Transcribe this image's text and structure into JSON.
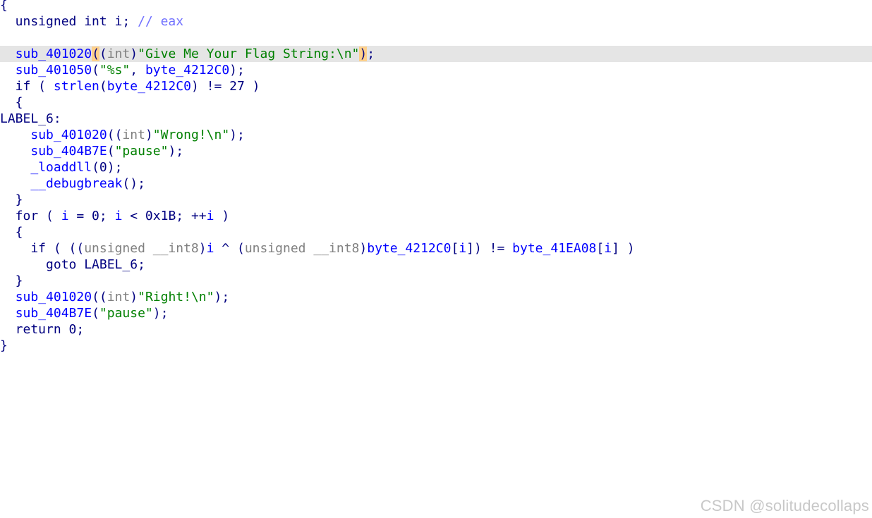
{
  "editor": {
    "current_line": 3,
    "lines": [
      {
        "tokens": [
          {
            "t": "{",
            "c": "plain"
          }
        ]
      },
      {
        "tokens": [
          {
            "t": "  unsigned int i; ",
            "c": "plain"
          },
          {
            "t": "// eax",
            "c": "cmt"
          }
        ]
      },
      {
        "tokens": []
      },
      {
        "tokens": [
          {
            "t": "  ",
            "c": "plain"
          },
          {
            "t": "sub_401020",
            "c": "func"
          },
          {
            "t": "(",
            "c": "paren-hl"
          },
          {
            "t": "(",
            "c": "plain"
          },
          {
            "t": "int",
            "c": "type"
          },
          {
            "t": ")",
            "c": "plain"
          },
          {
            "t": "\"Give Me Your Flag String:\\n\"",
            "c": "str"
          },
          {
            "t": ")",
            "c": "paren-hl"
          },
          {
            "t": ";",
            "c": "plain"
          }
        ]
      },
      {
        "tokens": [
          {
            "t": "  ",
            "c": "plain"
          },
          {
            "t": "sub_401050",
            "c": "func"
          },
          {
            "t": "(",
            "c": "plain"
          },
          {
            "t": "\"%s\"",
            "c": "str"
          },
          {
            "t": ", ",
            "c": "plain"
          },
          {
            "t": "byte_4212C0",
            "c": "func"
          },
          {
            "t": ");",
            "c": "plain"
          }
        ]
      },
      {
        "tokens": [
          {
            "t": "  if ( ",
            "c": "plain"
          },
          {
            "t": "strlen",
            "c": "func"
          },
          {
            "t": "(",
            "c": "plain"
          },
          {
            "t": "byte_4212C0",
            "c": "func"
          },
          {
            "t": ") != 27 )",
            "c": "plain"
          }
        ]
      },
      {
        "tokens": [
          {
            "t": "  {",
            "c": "plain"
          }
        ]
      },
      {
        "tokens": [
          {
            "t": "LABEL_6:",
            "c": "label"
          }
        ]
      },
      {
        "tokens": [
          {
            "t": "    ",
            "c": "plain"
          },
          {
            "t": "sub_401020",
            "c": "func"
          },
          {
            "t": "((",
            "c": "plain"
          },
          {
            "t": "int",
            "c": "type"
          },
          {
            "t": ")",
            "c": "plain"
          },
          {
            "t": "\"Wrong!\\n\"",
            "c": "str"
          },
          {
            "t": ");",
            "c": "plain"
          }
        ]
      },
      {
        "tokens": [
          {
            "t": "    ",
            "c": "plain"
          },
          {
            "t": "sub_404B7E",
            "c": "func"
          },
          {
            "t": "(",
            "c": "plain"
          },
          {
            "t": "\"pause\"",
            "c": "str"
          },
          {
            "t": ");",
            "c": "plain"
          }
        ]
      },
      {
        "tokens": [
          {
            "t": "    ",
            "c": "plain"
          },
          {
            "t": "_loaddll",
            "c": "func"
          },
          {
            "t": "(0);",
            "c": "plain"
          }
        ]
      },
      {
        "tokens": [
          {
            "t": "    ",
            "c": "plain"
          },
          {
            "t": "__debugbreak",
            "c": "func"
          },
          {
            "t": "();",
            "c": "plain"
          }
        ]
      },
      {
        "tokens": [
          {
            "t": "  }",
            "c": "plain"
          }
        ]
      },
      {
        "tokens": [
          {
            "t": "  for ( ",
            "c": "plain"
          },
          {
            "t": "i",
            "c": "var"
          },
          {
            "t": " = 0; ",
            "c": "plain"
          },
          {
            "t": "i",
            "c": "var"
          },
          {
            "t": " < 0x1B; ++",
            "c": "plain"
          },
          {
            "t": "i",
            "c": "var"
          },
          {
            "t": " )",
            "c": "plain"
          }
        ]
      },
      {
        "tokens": [
          {
            "t": "  {",
            "c": "plain"
          }
        ]
      },
      {
        "tokens": [
          {
            "t": "    if ( ((",
            "c": "plain"
          },
          {
            "t": "unsigned __int8",
            "c": "type"
          },
          {
            "t": ")",
            "c": "plain"
          },
          {
            "t": "i",
            "c": "var"
          },
          {
            "t": " ^ (",
            "c": "plain"
          },
          {
            "t": "unsigned __int8",
            "c": "type"
          },
          {
            "t": ")",
            "c": "plain"
          },
          {
            "t": "byte_4212C0",
            "c": "func"
          },
          {
            "t": "[",
            "c": "plain"
          },
          {
            "t": "i",
            "c": "var"
          },
          {
            "t": "]) != ",
            "c": "plain"
          },
          {
            "t": "byte_41EA08",
            "c": "func"
          },
          {
            "t": "[",
            "c": "plain"
          },
          {
            "t": "i",
            "c": "var"
          },
          {
            "t": "] )",
            "c": "plain"
          }
        ]
      },
      {
        "tokens": [
          {
            "t": "      goto LABEL_6;",
            "c": "plain"
          }
        ]
      },
      {
        "tokens": [
          {
            "t": "  }",
            "c": "plain"
          }
        ]
      },
      {
        "tokens": [
          {
            "t": "  ",
            "c": "plain"
          },
          {
            "t": "sub_401020",
            "c": "func"
          },
          {
            "t": "((",
            "c": "plain"
          },
          {
            "t": "int",
            "c": "type"
          },
          {
            "t": ")",
            "c": "plain"
          },
          {
            "t": "\"Right!\\n\"",
            "c": "str"
          },
          {
            "t": ");",
            "c": "plain"
          }
        ]
      },
      {
        "tokens": [
          {
            "t": "  ",
            "c": "plain"
          },
          {
            "t": "sub_404B7E",
            "c": "func"
          },
          {
            "t": "(",
            "c": "plain"
          },
          {
            "t": "\"pause\"",
            "c": "str"
          },
          {
            "t": ");",
            "c": "plain"
          }
        ]
      },
      {
        "tokens": [
          {
            "t": "  return 0;",
            "c": "plain"
          }
        ]
      },
      {
        "tokens": [
          {
            "t": "}",
            "c": "plain"
          }
        ]
      }
    ]
  },
  "watermark": "CSDN @solitudecollaps"
}
